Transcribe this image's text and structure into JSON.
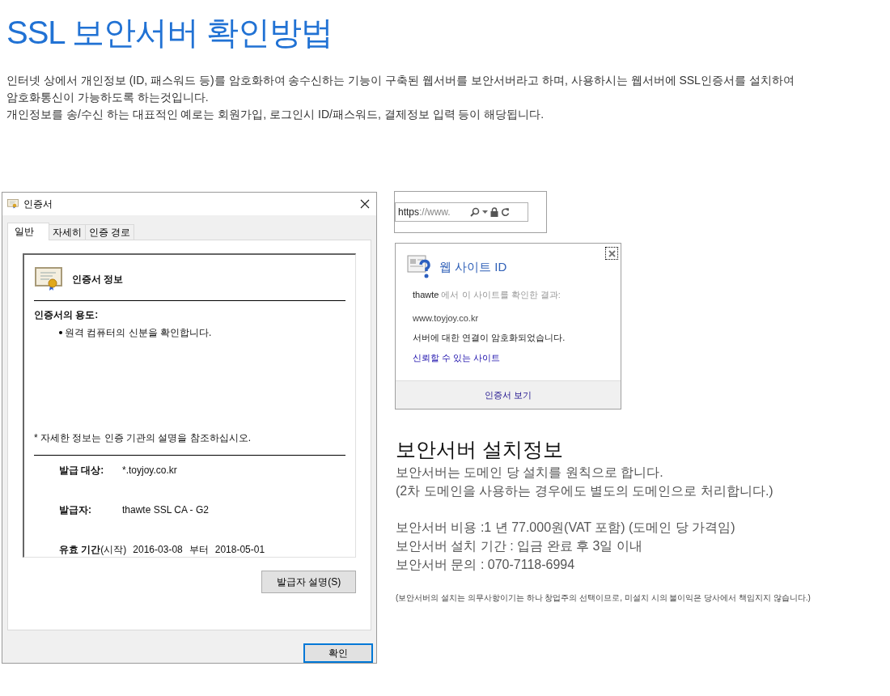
{
  "title": "SSL 보안서버 확인방법",
  "intro": [
    "인터넷 상에서 개인정보 (ID, 패스워드 등)를 암호화하여 송수신하는 기능이 구축된 웹서버를 보안서버라고 하며, 사용하시는 웹서버에 SSL인증서를 설치하여",
    "암호화통신이 가능하도록 하는것입니다.",
    "개인정보를 송/수신 하는 대표적인 예로는 회원가입, 로그인시 ID/패스워드, 결제정보 입력 등이 해당됩니다."
  ],
  "cert_dialog": {
    "title": "인증서",
    "tabs": [
      {
        "label": "일반",
        "selected": true
      },
      {
        "label": "자세히",
        "selected": false
      },
      {
        "label": "인증 경로",
        "selected": false
      }
    ],
    "header": "인증서 정보",
    "purpose_label": "인증서의 용도:",
    "purposes": [
      "원격 컴퓨터의 신분을 확인합니다."
    ],
    "note": "* 자세한 정보는 인증 기관의 설명을 참조하십시오.",
    "fields": [
      {
        "label": "발급 대상:",
        "value": "*.toyjoy.co.kr"
      },
      {
        "label": "발급자:",
        "value": "thawte SSL CA - G2"
      }
    ],
    "validity": {
      "label": "**유효 기간**(시작)",
      "from": "2016-03-08",
      "between": "부터",
      "to": "2018-05-01"
    },
    "issuer_button": "발급자 설명(S)",
    "ok_button": "확인"
  },
  "address_bar": {
    "scheme": "https",
    "rest": "://www."
  },
  "site_id": {
    "title": "웹 사이트 ID",
    "issuer": "thawte",
    "verified_text": "에서 이 사이트를 확인한 결과:",
    "domain": "www.toyjoy.co.kr",
    "status": "서버에 대한 연결이 암호화되었습니다.",
    "trust_link": "신뢰할 수 있는 사이트",
    "view_button": "인증서 보기"
  },
  "install_info": {
    "heading": "보안서버 설치정보",
    "groups": [
      [
        "보안서버는 도메인 당 설치를 원칙으로 합니다.",
        "(2차 도메인을 사용하는 경우에도 별도의 도메인으로 처리합니다.)"
      ],
      [
        "보안서버 비용 :1 년 77.000원(VAT 포함) (도메인 당 가격임)",
        "보안서버 설치 기간 : 입금 완료 후 3일 이내",
        "보안서버 문의 : 070-7118-6994"
      ]
    ],
    "footnote": "(보안서버의 설치는 의무사항이기는 하나 창업주의 선택이므로, 미설치 시의 불이익은 당사에서 책임지지 않습니다.)"
  }
}
